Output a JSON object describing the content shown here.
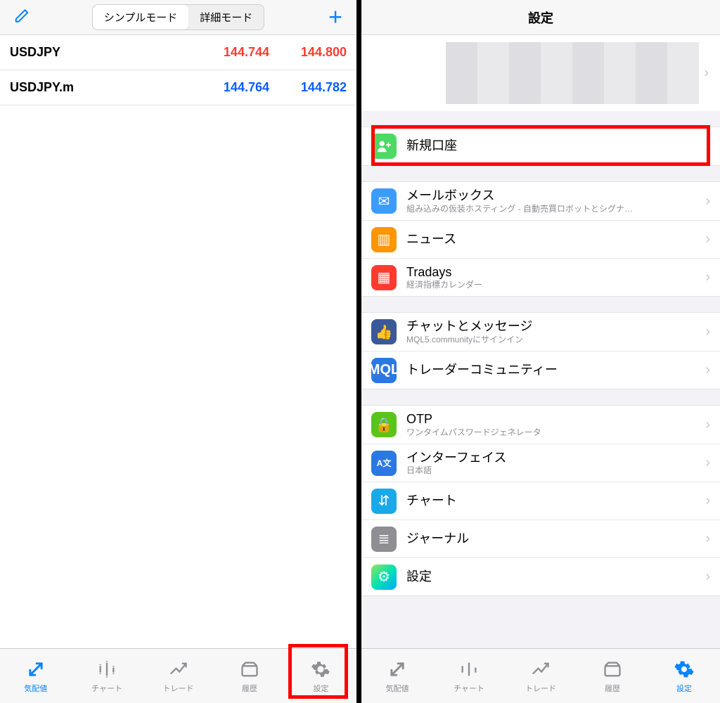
{
  "left": {
    "segments": {
      "simple": "シンプルモード",
      "detail": "詳細モード"
    },
    "rows": [
      {
        "symbol": "USDJPY",
        "bid": "144.744",
        "ask": "144.800",
        "tone": "red"
      },
      {
        "symbol": "USDJPY.m",
        "bid": "144.764",
        "ask": "144.782",
        "tone": "blue"
      }
    ],
    "tabs": {
      "quotes": "気配値",
      "chart": "チャート",
      "trade": "トレード",
      "history": "履歴",
      "settings": "設定"
    }
  },
  "right": {
    "title": "設定",
    "g1": [
      {
        "id": "new-account",
        "title": "新規口座",
        "sub": "",
        "iconClass": "bg-green",
        "glyph": "👤+"
      }
    ],
    "g2": [
      {
        "id": "mailbox",
        "title": "メールボックス",
        "sub": "組み込みの仮装ホスティング - 自動売買ロボットとシグナ…",
        "iconClass": "bg-blue",
        "glyph": "✉"
      },
      {
        "id": "news",
        "title": "ニュース",
        "sub": "",
        "iconClass": "bg-orange",
        "glyph": "📖"
      },
      {
        "id": "tradays",
        "title": "Tradays",
        "sub": "経済指標カレンダー",
        "iconClass": "bg-red",
        "glyph": "📅"
      }
    ],
    "g3": [
      {
        "id": "chat",
        "title": "チャットとメッセージ",
        "sub": "MQL5.communityにサインイン",
        "iconClass": "bg-fb",
        "glyph": "👍"
      },
      {
        "id": "community",
        "title": "トレーダーコミュニティー",
        "sub": "",
        "iconClass": "bg-mql",
        "glyph": "MQL"
      }
    ],
    "g4": [
      {
        "id": "otp",
        "title": "OTP",
        "sub": "ワンタイムパスワードジェネレータ",
        "iconClass": "bg-lime",
        "glyph": "🔒"
      },
      {
        "id": "iface",
        "title": "インターフェイス",
        "sub": "日本語",
        "iconClass": "bg-az",
        "glyph": "A文"
      },
      {
        "id": "charts",
        "title": "チャート",
        "sub": "",
        "iconClass": "bg-cyan",
        "glyph": "📊"
      },
      {
        "id": "journal",
        "title": "ジャーナル",
        "sub": "",
        "iconClass": "bg-gray",
        "glyph": "≣"
      },
      {
        "id": "settings",
        "title": "設定",
        "sub": "",
        "iconClass": "bg-multi",
        "glyph": "⚙"
      }
    ],
    "tabs": {
      "quotes": "気配値",
      "chart": "チャート",
      "trade": "トレード",
      "history": "履歴",
      "settings": "設定"
    }
  }
}
